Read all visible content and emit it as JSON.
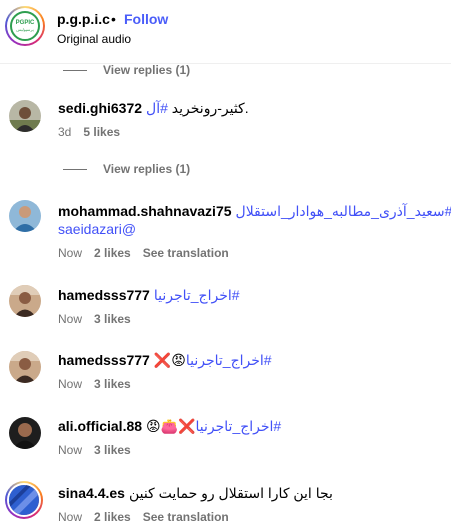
{
  "post": {
    "username": "p.g.p.i.c",
    "separator": "•",
    "follow_label": "Follow",
    "audio_label": "Original audio",
    "logo_text": "PGPIC",
    "logo_sub": "پرسپولیس"
  },
  "view_replies": [
    "View replies (1)",
    "View replies (1)"
  ],
  "comments": [
    {
      "username": "sedi.ghi6372",
      "tag": "#آل",
      "text": ".کثیر-رونخرید",
      "time": "3d",
      "likes": "5 likes"
    },
    {
      "username": "mohammad.shahnavazi75",
      "tag": "#سعید_آذری_مطالبه_هوادار_استقلال",
      "text2": "saeidazari@",
      "time": "Now",
      "likes": "2 likes",
      "translation": "See translation"
    },
    {
      "username": "hamedsss777",
      "tag": "#اخراج_تاجرنیا",
      "time": "Now",
      "likes": "3 likes"
    },
    {
      "username": "hamedsss777",
      "tag": "#اخراج_تاجرنیا",
      "emoji": "😡❌",
      "time": "Now",
      "likes": "3 likes"
    },
    {
      "username": "ali.official.88",
      "tag": "#اخراج_تاجرنیا",
      "emoji": "❌👛😡",
      "time": "Now",
      "likes": "3 likes"
    },
    {
      "username": "sina4.4.es",
      "text": "بجا این کارا استقلال رو حمایت کنین",
      "time": "Now",
      "likes": "2 likes",
      "translation": "See translation"
    }
  ]
}
